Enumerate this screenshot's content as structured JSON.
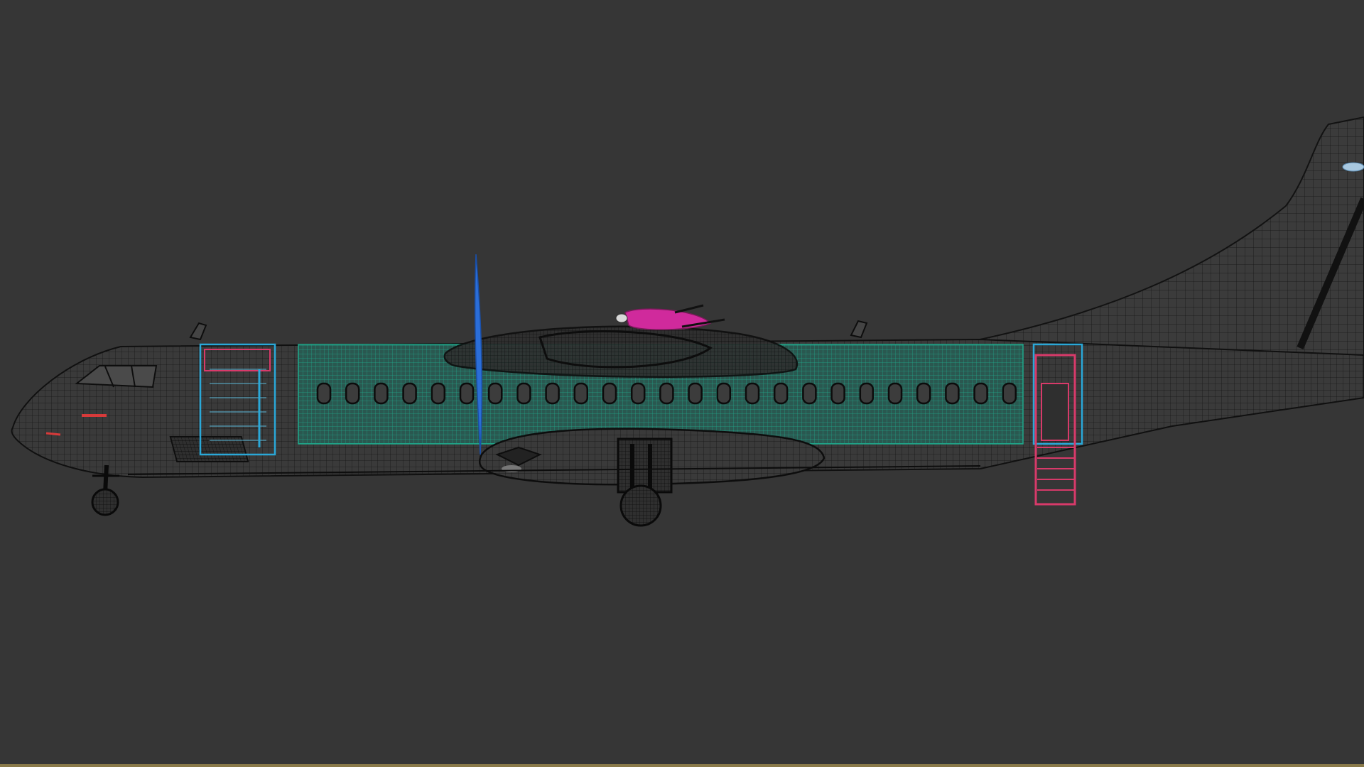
{
  "viewport": {
    "background": "#363636",
    "frame_color": "#8a7a4a",
    "wire_color": "#111111",
    "cabin_color": "#1f9e84",
    "door_color": "#2aa8d8",
    "accent_magenta": "#d02a9c",
    "accent_red": "#d83a3a",
    "prop_color": "#2b6ed8"
  },
  "model": {
    "view": "side-orthographic",
    "render_mode": "wireframe"
  }
}
